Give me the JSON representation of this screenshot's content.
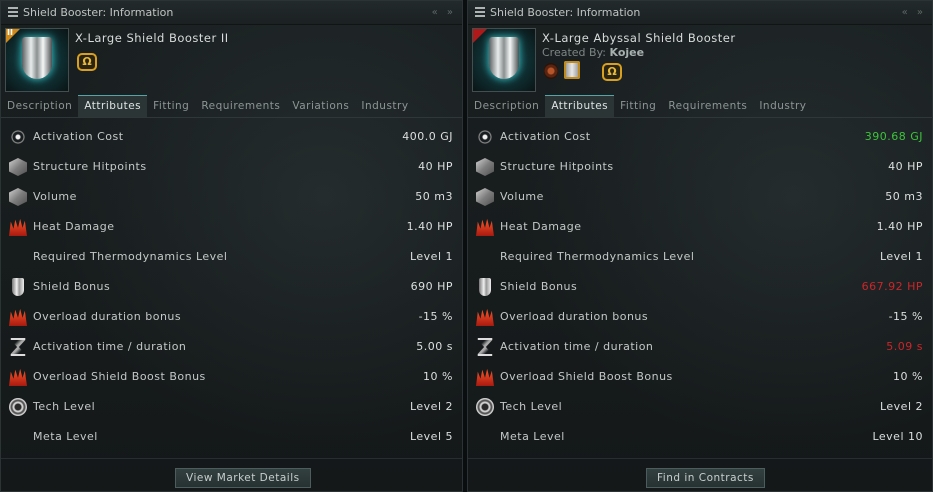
{
  "left": {
    "title": "Shield Booster: Information",
    "item_name": "X-Large Shield Booster II",
    "tech_badge": "II",
    "omega": "Ω",
    "tabs": [
      "Description",
      "Attributes",
      "Fitting",
      "Requirements",
      "Variations",
      "Industry"
    ],
    "active_tab": "Attributes",
    "attributes": [
      {
        "icon": "capacitor-icon",
        "label": "Activation Cost",
        "value": "400.0 GJ"
      },
      {
        "icon": "structure-icon",
        "label": "Structure Hitpoints",
        "value": "40 HP"
      },
      {
        "icon": "volume-icon",
        "label": "Volume",
        "value": "50 m3"
      },
      {
        "icon": "heat-icon",
        "label": "Heat Damage",
        "value": "1.40 HP"
      },
      {
        "icon": "",
        "label": "Required Thermodynamics Level",
        "value": "Level 1"
      },
      {
        "icon": "shield-icon",
        "label": "Shield Bonus",
        "value": "690 HP"
      },
      {
        "icon": "heat-icon",
        "label": "Overload duration bonus",
        "value": "-15 %"
      },
      {
        "icon": "hourglass-icon",
        "label": "Activation time / duration",
        "value": "5.00 s"
      },
      {
        "icon": "heat-icon",
        "label": "Overload Shield Boost Bonus",
        "value": "10 %"
      },
      {
        "icon": "tech-level-icon",
        "label": "Tech Level",
        "value": "Level 2"
      },
      {
        "icon": "",
        "label": "Meta Level",
        "value": "Level 5"
      }
    ],
    "button": "View Market Details"
  },
  "right": {
    "title": "Shield Booster: Information",
    "item_name": "X-Large Abyssal Shield Booster",
    "created_by_label": "Created By:",
    "created_by": "Kojee",
    "omega": "Ω",
    "tabs": [
      "Description",
      "Attributes",
      "Fitting",
      "Requirements",
      "Industry"
    ],
    "active_tab": "Attributes",
    "attributes": [
      {
        "icon": "capacitor-icon",
        "label": "Activation Cost",
        "value": "390.68 GJ",
        "status": "better"
      },
      {
        "icon": "structure-icon",
        "label": "Structure Hitpoints",
        "value": "40 HP"
      },
      {
        "icon": "volume-icon",
        "label": "Volume",
        "value": "50 m3"
      },
      {
        "icon": "heat-icon",
        "label": "Heat Damage",
        "value": "1.40 HP"
      },
      {
        "icon": "",
        "label": "Required Thermodynamics Level",
        "value": "Level 1"
      },
      {
        "icon": "shield-icon",
        "label": "Shield Bonus",
        "value": "667.92 HP",
        "status": "worse"
      },
      {
        "icon": "heat-icon",
        "label": "Overload duration bonus",
        "value": "-15 %"
      },
      {
        "icon": "hourglass-icon",
        "label": "Activation time / duration",
        "value": "5.09 s",
        "status": "worse"
      },
      {
        "icon": "heat-icon",
        "label": "Overload Shield Boost Bonus",
        "value": "10 %"
      },
      {
        "icon": "tech-level-icon",
        "label": "Tech Level",
        "value": "Level 2"
      },
      {
        "icon": "",
        "label": "Meta Level",
        "value": "Level 10"
      }
    ],
    "button": "Find in Contracts"
  },
  "colors": {
    "better": "#3cc43c",
    "worse": "#c9262a",
    "accent": "#56a3a9",
    "omega": "#d9a020"
  }
}
